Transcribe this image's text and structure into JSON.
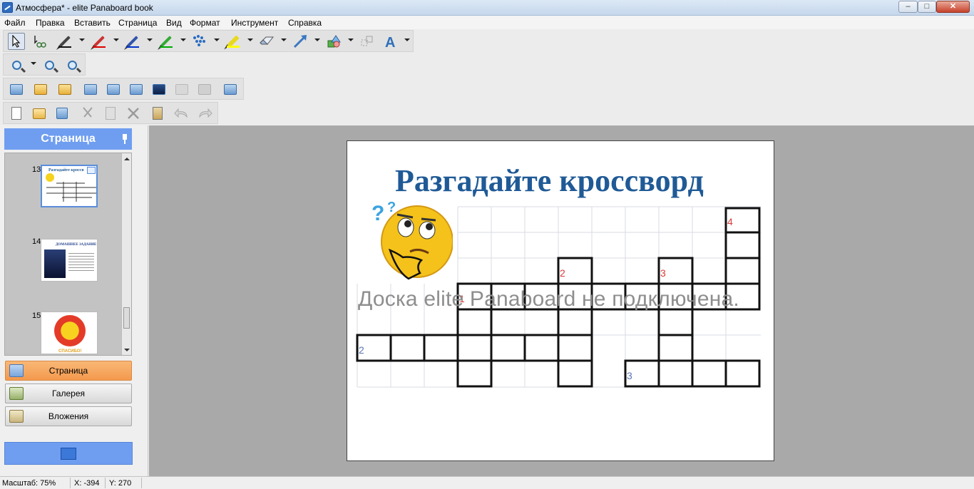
{
  "window": {
    "title": "Атмосфера* - elite Panaboard book",
    "minimize": "‒",
    "maximize": "□",
    "close": "✕"
  },
  "menu": [
    "Файл",
    "Правка",
    "Вставить",
    "Страница",
    "Вид",
    "Формат",
    "Инструмент",
    "Справка"
  ],
  "colors": {
    "accent": "#6f9ef0",
    "active_tab": "#f4994d",
    "workspace": "#a9a9a9",
    "title_blue": "#1f5a96",
    "number_red": "#d83a3a"
  },
  "toolbars": {
    "drawing": [
      "select-arrow-icon",
      "lasso-icon",
      "pen-black-icon",
      "pen-red-icon",
      "pen-blue-icon",
      "pen-green-icon",
      "magic-pen-icon",
      "highlighter-icon",
      "eraser-icon",
      "line-icon",
      "shape-icon",
      "group-icon",
      "text-icon"
    ],
    "zoom": [
      "zoom-icon",
      "zoom-in-icon",
      "zoom-out-icon"
    ],
    "page": [
      "add-page-icon",
      "prev-page-icon",
      "next-page-icon",
      "camera-icon",
      "capture-screen-icon",
      "capture-window-icon",
      "capture-video-icon",
      "keyboard-icon",
      "stamp-icon",
      "fullscreen-icon"
    ],
    "file": [
      "new-file-icon",
      "open-file-icon",
      "save-icon",
      "cut-icon",
      "copy-icon",
      "delete-icon",
      "paste-icon",
      "undo-icon",
      "redo-icon"
    ]
  },
  "sidebar": {
    "header": "Страница",
    "pages": [
      {
        "number": "13",
        "caption": "Разгадайте кроссв"
      },
      {
        "number": "14",
        "caption": "ДОМАШНЕЕ ЗАДАНИЕ"
      },
      {
        "number": "15",
        "caption": "СПАСИБО!"
      }
    ],
    "tabs": [
      "Страница",
      "Галерея",
      "Вложения"
    ]
  },
  "slide": {
    "title": "Разгадайте кроссворд",
    "overlay": "Доска elite Panaboard не подключена.",
    "clue_numbers": {
      "n1": "1",
      "n2": "2",
      "n3": "3",
      "n4": "4",
      "r2": "2",
      "r3": "3"
    }
  },
  "status": {
    "zoom": "Масштаб: 75%",
    "x": "X: -394",
    "y": "Y: 270"
  }
}
